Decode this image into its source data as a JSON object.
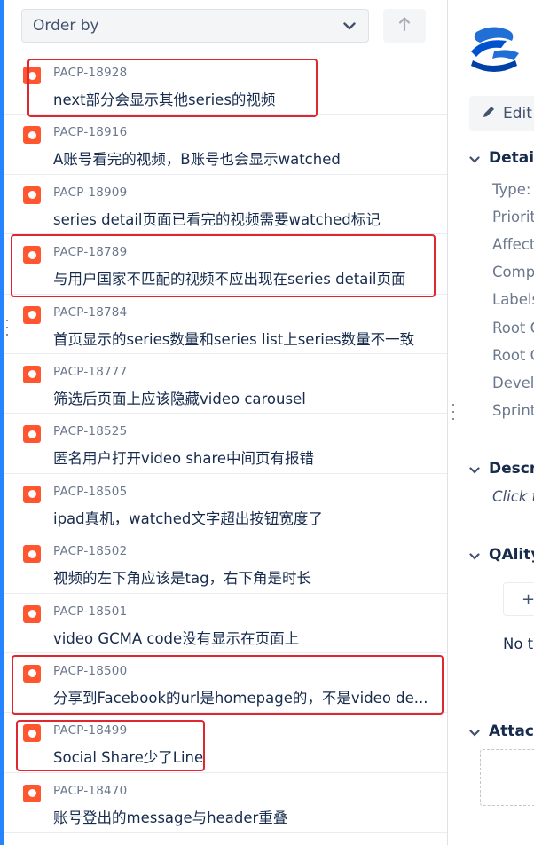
{
  "toolbar": {
    "order_by_label": "Order by",
    "chevron_icon": "chevron-down-icon",
    "sort_icon": "arrow-up-icon"
  },
  "issues": [
    {
      "key": "PACP-18928",
      "summary": "next部分会显示其他series的视频",
      "highlighted": true
    },
    {
      "key": "PACP-18916",
      "summary": "A账号看完的视频，B账号也会显示watched",
      "highlighted": false
    },
    {
      "key": "PACP-18909",
      "summary": "series detail页面已看完的视频需要watched标记",
      "highlighted": false
    },
    {
      "key": "PACP-18789",
      "summary": "与用户国家不匹配的视频不应出现在series detail页面",
      "highlighted": true
    },
    {
      "key": "PACP-18784",
      "summary": "首页显示的series数量和series list上series数量不一致",
      "highlighted": false
    },
    {
      "key": "PACP-18777",
      "summary": "筛选后页面上应该隐藏video carousel",
      "highlighted": false
    },
    {
      "key": "PACP-18525",
      "summary": "匿名用户打开video share中间页有报错",
      "highlighted": false
    },
    {
      "key": "PACP-18505",
      "summary": "ipad真机，watched文字超出按钮宽度了",
      "highlighted": false
    },
    {
      "key": "PACP-18502",
      "summary": "视频的左下角应该是tag，右下角是时长",
      "highlighted": false
    },
    {
      "key": "PACP-18501",
      "summary": "video GCMA code没有显示在页面上",
      "highlighted": false
    },
    {
      "key": "PACP-18500",
      "summary": "分享到Facebook的url是homepage的，不是video de...",
      "highlighted": true
    },
    {
      "key": "PACP-18499",
      "summary": "Social Share少了Line",
      "highlighted": true
    },
    {
      "key": "PACP-18470",
      "summary": "账号登出的message与header重叠",
      "highlighted": false
    }
  ],
  "right_panel": {
    "edit_label": "Edit",
    "details_title": "Details",
    "fields": [
      "Type:",
      "Priority:",
      "Affects Version/s:",
      "Component/s:",
      "Labels:",
      "Root Cause:",
      "Root Cause Details:",
      "Development:",
      "Sprints:"
    ],
    "description_title": "Description",
    "description_placeholder": "Click to add description",
    "qality_title": "QAlity",
    "add_label": "+",
    "no_text": "No tests",
    "attachments_title": "Attachments"
  },
  "colors": {
    "bug_icon": "#FF5630",
    "highlight_box": "#E0262E",
    "left_accent": "#2684FF",
    "logo_blue": "#0052CC"
  }
}
